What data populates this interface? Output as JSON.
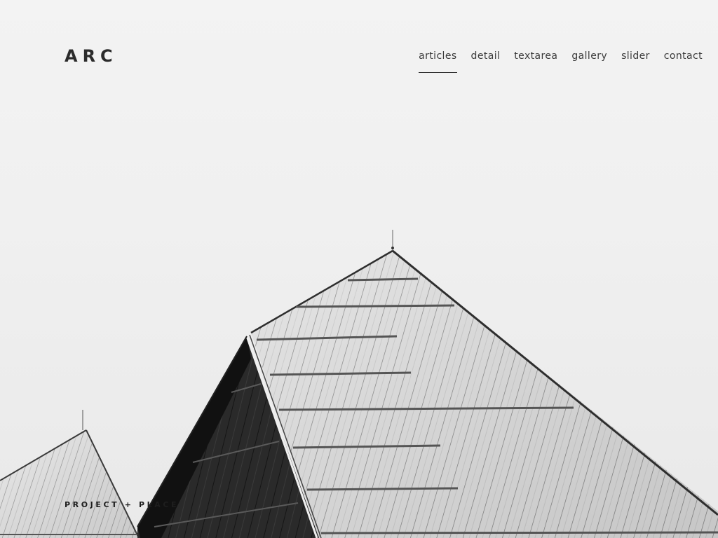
{
  "brand": {
    "logo_text": "ARC"
  },
  "nav": {
    "items": [
      {
        "label": "articles",
        "active": true
      },
      {
        "label": "detail",
        "active": false
      },
      {
        "label": "textarea",
        "active": false
      },
      {
        "label": "gallery",
        "active": false
      },
      {
        "label": "slider",
        "active": false
      },
      {
        "label": "contact",
        "active": false
      }
    ]
  },
  "hero": {
    "caption": "PROJECT + PLACE",
    "background_color": "#f1f1f1",
    "roof_color": "#dcdcdc",
    "dark_face_color": "#1d1d1d"
  }
}
